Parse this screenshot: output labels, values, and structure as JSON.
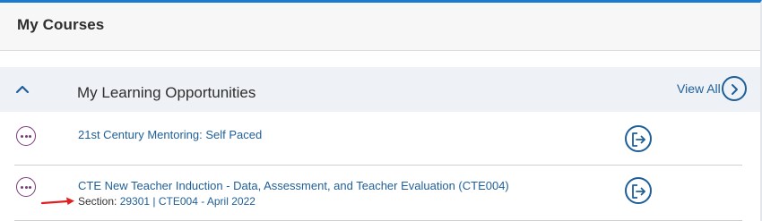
{
  "panel": {
    "title": "My Courses"
  },
  "section": {
    "title": "My Learning Opportunities",
    "view_all_label": "View All",
    "collapse_icon": "chevron-up-icon",
    "view_all_icon": "chevron-right-circle-icon"
  },
  "courses": [
    {
      "title": "21st Century Mentoring: Self Paced",
      "menu_icon": "more-options-icon",
      "launch_icon": "launch-icon"
    },
    {
      "title": "CTE New Teacher Induction - Data, Assessment, and Teacher Evaluation (CTE004)",
      "section_label": "Section:",
      "section_detail": "29301 | CTE004 - April 2022",
      "menu_icon": "more-options-icon",
      "launch_icon": "launch-icon"
    }
  ],
  "colors": {
    "accent": "#1a7bd0",
    "link": "#1f5f99",
    "menu_icon": "#7a3a7a",
    "annotation_arrow": "#e02020"
  }
}
